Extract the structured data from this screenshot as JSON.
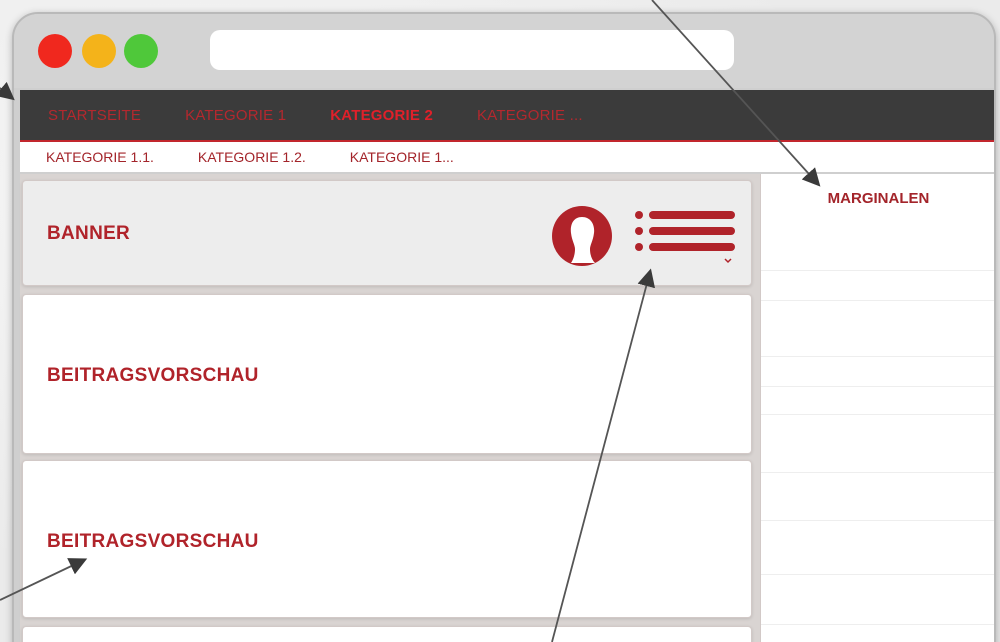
{
  "window": {
    "traffic_lights": [
      {
        "name": "close",
        "color": "#f0281e"
      },
      {
        "name": "minimize",
        "color": "#f4b31a"
      },
      {
        "name": "maximize",
        "color": "#4fc83a"
      }
    ],
    "url": ""
  },
  "main_nav": {
    "items": [
      {
        "label": "STARTSEITE",
        "active": false
      },
      {
        "label": "KATEGORIE 1",
        "active": false
      },
      {
        "label": "KATEGORIE 2",
        "active": true
      },
      {
        "label": "KATEGORIE ...",
        "active": false
      }
    ]
  },
  "sub_nav": {
    "items": [
      {
        "label": "KATEGORIE 1.1."
      },
      {
        "label": "KATEGORIE 1.2."
      },
      {
        "label": "KATEGORIE 1..."
      }
    ]
  },
  "banner": {
    "title": "BANNER",
    "icons": [
      "user-icon",
      "menu-icon"
    ]
  },
  "previews": [
    {
      "title": "BEITRAGSVORSCHAU"
    },
    {
      "title": "BEITRAGSVORSCHAU"
    }
  ],
  "sidebar": {
    "title": "MARGINALEN"
  },
  "colors": {
    "accent": "#b0232a",
    "nav_bg": "#3b3b3b",
    "frame": "#cfcfcf"
  }
}
